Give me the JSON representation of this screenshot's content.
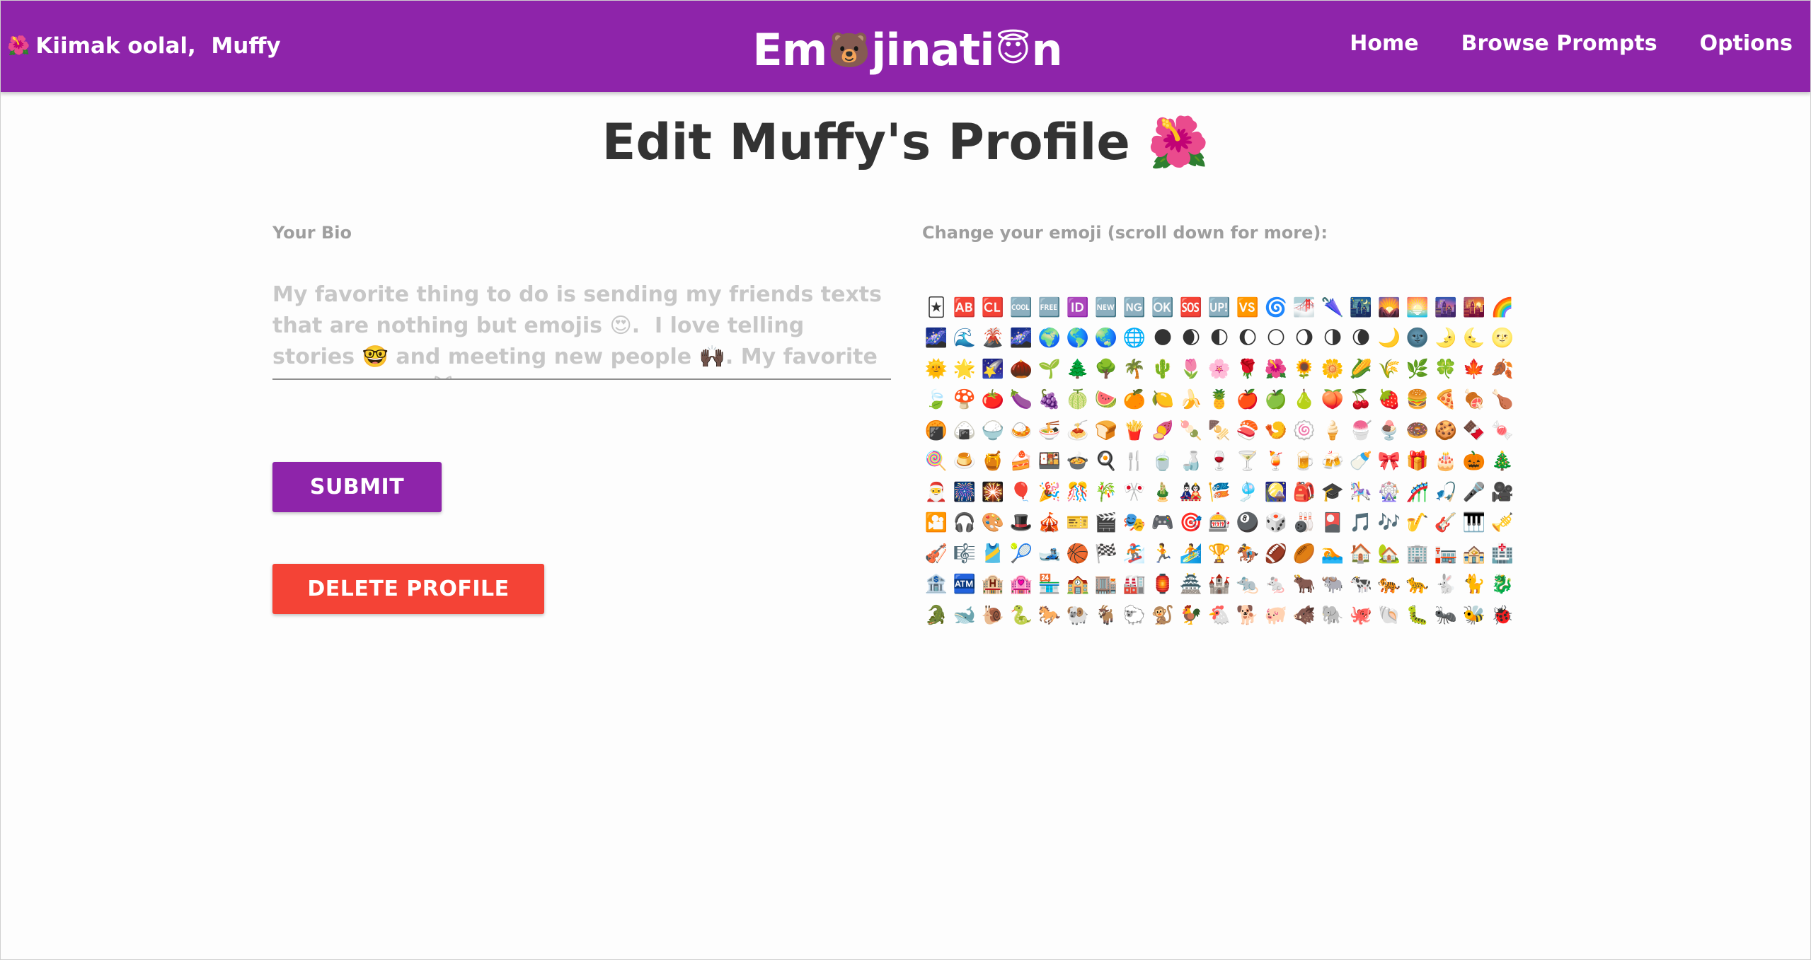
{
  "header": {
    "greeting_icon": "🌺",
    "greeting": "Kiimak oolal,  Muffy",
    "brand_part1": "Em",
    "brand_emoji1": "🐻",
    "brand_part2": "jinati",
    "brand_emoji2": "😇",
    "brand_part3": "n",
    "nav": {
      "home": "Home",
      "browse": "Browse Prompts",
      "options": "Options"
    }
  },
  "page": {
    "title": "Edit Muffy's Profile 🌺"
  },
  "bio": {
    "label": "Your Bio",
    "value": "My favorite thing to do is sending my friends texts that are nothing but emojis 😍.  I love telling stories 🤓 and meeting new people 🙌🏿. My favorite animal is cat 😻 and I want to go"
  },
  "buttons": {
    "submit": "SUBMIT",
    "delete": "DELETE PROFILE"
  },
  "emoji_picker": {
    "label": "Change your emoji (scroll down for more):",
    "emojis": [
      "🃏",
      "🆎",
      "🆑",
      "🆒",
      "🆓",
      "🆔",
      "🆕",
      "🆖",
      "🆗",
      "🆘",
      "🆙",
      "🆚",
      "🌀",
      "🌁",
      "🌂",
      "🌃",
      "🌄",
      "🌅",
      "🌆",
      "🌇",
      "🌈",
      "🌌",
      "🌊",
      "🌋",
      "🌌",
      "🌍",
      "🌎",
      "🌏",
      "🌐",
      "🌑",
      "🌒",
      "🌓",
      "🌔",
      "🌕",
      "🌖",
      "🌗",
      "🌘",
      "🌙",
      "🌚",
      "🌛",
      "🌜",
      "🌝",
      "🌞",
      "🌟",
      "🌠",
      "🌰",
      "🌱",
      "🌲",
      "🌳",
      "🌴",
      "🌵",
      "🌷",
      "🌸",
      "🌹",
      "🌺",
      "🌻",
      "🌼",
      "🌽",
      "🌾",
      "🌿",
      "🍀",
      "🍁",
      "🍂",
      "🍃",
      "🍄",
      "🍅",
      "🍆",
      "🍇",
      "🍈",
      "🍉",
      "🍊",
      "🍋",
      "🍌",
      "🍍",
      "🍎",
      "🍏",
      "🍐",
      "🍑",
      "🍒",
      "🍓",
      "🍔",
      "🍕",
      "🍖",
      "🍗",
      "🍘",
      "🍙",
      "🍚",
      "🍛",
      "🍜",
      "🍝",
      "🍞",
      "🍟",
      "🍠",
      "🍡",
      "🍢",
      "🍣",
      "🍤",
      "🍥",
      "🍦",
      "🍧",
      "🍨",
      "🍩",
      "🍪",
      "🍫",
      "🍬",
      "🍭",
      "🍮",
      "🍯",
      "🍰",
      "🍱",
      "🍲",
      "🍳",
      "🍴",
      "🍵",
      "🍶",
      "🍷",
      "🍸",
      "🍹",
      "🍺",
      "🍻",
      "🍼",
      "🎀",
      "🎁",
      "🎂",
      "🎃",
      "🎄",
      "🎅",
      "🎆",
      "🎇",
      "🎈",
      "🎉",
      "🎊",
      "🎋",
      "🎌",
      "🎍",
      "🎎",
      "🎏",
      "🎐",
      "🎑",
      "🎒",
      "🎓",
      "🎠",
      "🎡",
      "🎢",
      "🎣",
      "🎤",
      "🎥",
      "🎦",
      "🎧",
      "🎨",
      "🎩",
      "🎪",
      "🎫",
      "🎬",
      "🎭",
      "🎮",
      "🎯",
      "🎰",
      "🎱",
      "🎲",
      "🎳",
      "🎴",
      "🎵",
      "🎶",
      "🎷",
      "🎸",
      "🎹",
      "🎺",
      "🎻",
      "🎼",
      "🎽",
      "🎾",
      "🎿",
      "🏀",
      "🏁",
      "🏂",
      "🏃",
      "🏄",
      "🏆",
      "🏇",
      "🏈",
      "🏉",
      "🏊",
      "🏠",
      "🏡",
      "🏢",
      "🏣",
      "🏤",
      "🏥",
      "🏦",
      "🏧",
      "🏨",
      "🏩",
      "🏪",
      "🏫",
      "🏬",
      "🏭",
      "🏮",
      "🏯",
      "🏰",
      "🐀",
      "🐁",
      "🐂",
      "🐃",
      "🐄",
      "🐅",
      "🐆",
      "🐇",
      "🐈",
      "🐉",
      "🐊",
      "🐋",
      "🐌",
      "🐍",
      "🐎",
      "🐏",
      "🐐",
      "🐑",
      "🐒",
      "🐓",
      "🐔",
      "🐕",
      "🐖",
      "🐗",
      "🐘",
      "🐙",
      "🐚",
      "🐛",
      "🐜",
      "🐝",
      "🐞"
    ]
  }
}
